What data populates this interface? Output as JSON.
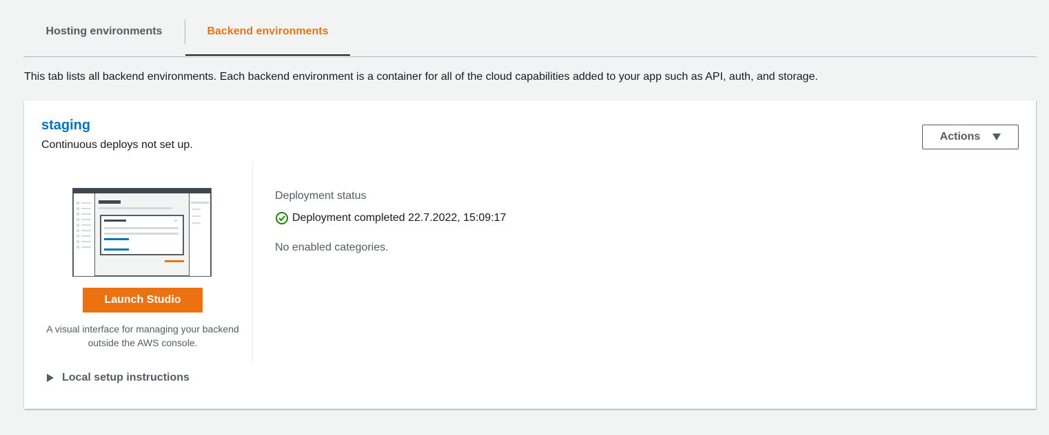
{
  "tabs": [
    {
      "label": "Hosting environments",
      "active": false
    },
    {
      "label": "Backend environments",
      "active": true
    }
  ],
  "description": "This tab lists all backend environments. Each backend environment is a container for all of the cloud capabilities added to your app such as API, auth, and storage.",
  "environment": {
    "name": "staging",
    "subtitle": "Continuous deploys not set up.",
    "actions_label": "Actions",
    "launch_label": "Launch Studio",
    "studio_description": "A visual interface for managing your backend outside the AWS console.",
    "deployment_label": "Deployment status",
    "deployment_status": "Deployment completed 22.7.2022, 15:09:17",
    "categories": "No enabled categories.",
    "local_setup": "Local setup instructions"
  },
  "colors": {
    "accent_orange": "#ec7211",
    "link_blue": "#0073bb",
    "success_green": "#1d8102"
  },
  "icons": {
    "status": "check-circle-icon",
    "actions": "caret-down-icon",
    "expand": "caret-right-icon"
  }
}
